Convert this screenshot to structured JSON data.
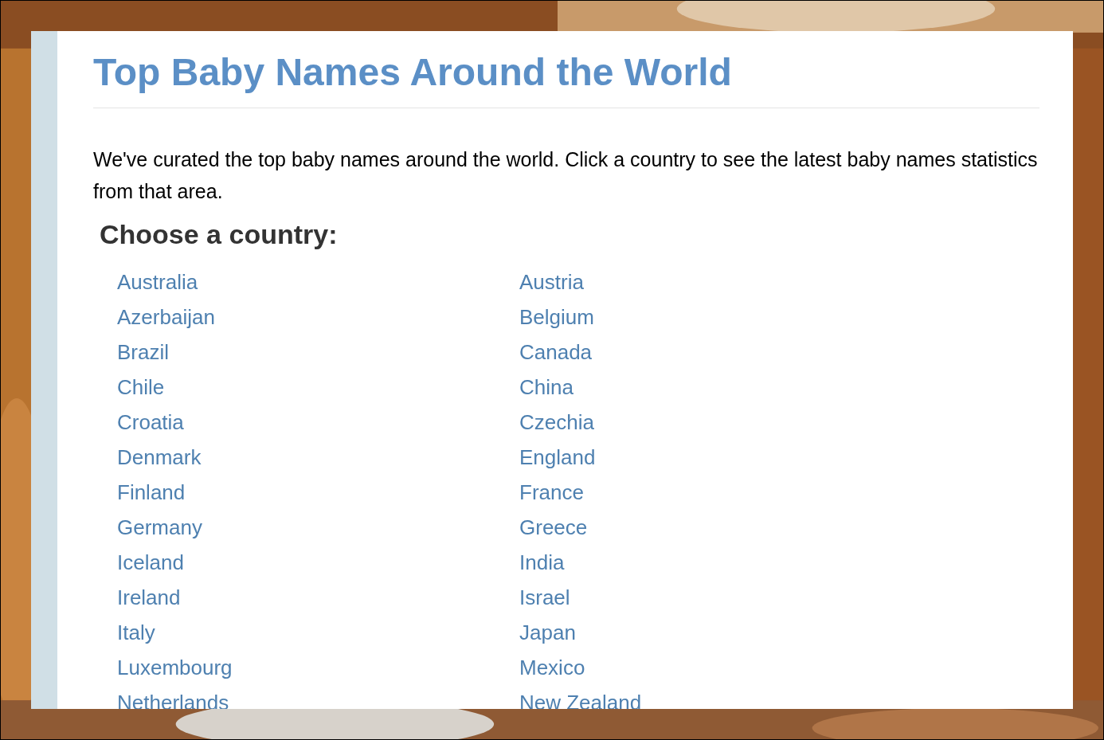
{
  "page": {
    "title": "Top Baby Names Around the World",
    "intro": "We've curated the top baby names around the world. Click a country to see the latest baby names statistics from that area.",
    "heading": "Choose a country:"
  },
  "countries": [
    "Australia",
    "Austria",
    "Azerbaijan",
    "Belgium",
    "Brazil",
    "Canada",
    "Chile",
    "China",
    "Croatia",
    "Czechia",
    "Denmark",
    "England",
    "Finland",
    "France",
    "Germany",
    "Greece",
    "Iceland",
    "India",
    "Ireland",
    "Israel",
    "Italy",
    "Japan",
    "Luxembourg",
    "Mexico",
    "Netherlands",
    "New Zealand"
  ]
}
